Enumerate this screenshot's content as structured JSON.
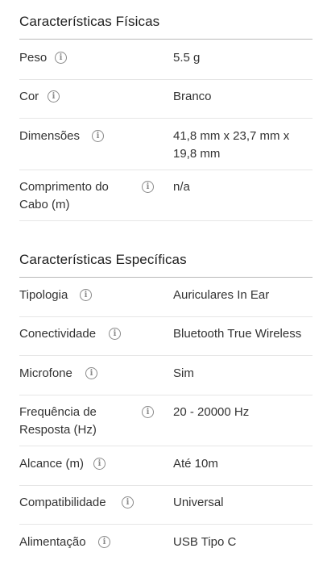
{
  "sections": [
    {
      "title": "Características Físicas",
      "rows": [
        {
          "label": "Peso",
          "value": "5.5 g"
        },
        {
          "label": "Cor",
          "value": "Branco"
        },
        {
          "label": "Dimensões",
          "value": "41,8 mm x 23,7 mm x 19,8 mm"
        },
        {
          "label": "Comprimento do Cabo (m)",
          "value": "n/a"
        }
      ]
    },
    {
      "title": "Características Específicas",
      "rows": [
        {
          "label": "Tipologia",
          "value": "Auriculares In Ear"
        },
        {
          "label": "Conectividade",
          "value": "Bluetooth True Wireless"
        },
        {
          "label": "Microfone",
          "value": "Sim"
        },
        {
          "label": "Frequência de Resposta (Hz)",
          "value": "20 - 20000 Hz"
        },
        {
          "label": "Alcance (m)",
          "value": "Até 10m"
        },
        {
          "label": "Compatibilidade",
          "value": "Universal"
        },
        {
          "label": "Alimentação",
          "value": "USB Tipo C"
        }
      ]
    }
  ],
  "info_icon": "info-circle-icon"
}
